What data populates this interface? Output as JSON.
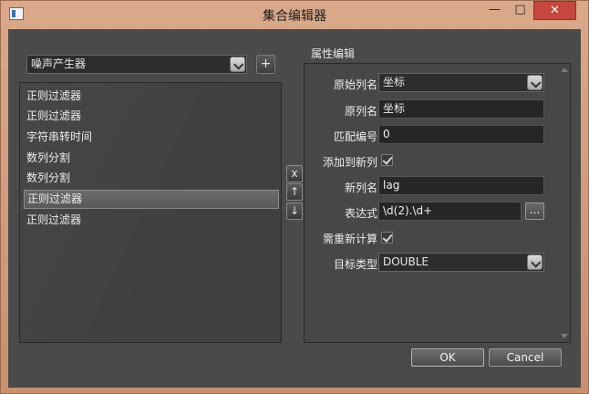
{
  "window": {
    "title": "集合编辑器",
    "min_glyph": "—",
    "max_glyph": "□",
    "close_glyph": "✕"
  },
  "left": {
    "generator_select": {
      "value": "噪声产生器"
    },
    "add_button": "+",
    "items": [
      {
        "label": "正则过滤器",
        "selected": false
      },
      {
        "label": "正则过滤器",
        "selected": false
      },
      {
        "label": "字符串转时间",
        "selected": false
      },
      {
        "label": "数列分割",
        "selected": false
      },
      {
        "label": "数列分割",
        "selected": false
      },
      {
        "label": "正则过滤器",
        "selected": true
      },
      {
        "label": "正则过滤器",
        "selected": false
      }
    ],
    "remove_button": "x",
    "up_button": "↑",
    "down_button": "↓"
  },
  "props": {
    "title": "属性编辑",
    "original_column_label": "原始列名",
    "original_column_value": "坐标",
    "source_name_label": "原列名",
    "source_name_value": "坐标",
    "match_index_label": "匹配编号",
    "match_index_value": "0",
    "add_to_new_column_label": "添加到新列",
    "add_to_new_column_checked": true,
    "new_column_label": "新列名",
    "new_column_value": "lag",
    "expression_label": "表达式",
    "expression_value": "\\d(2).\\d+",
    "expression_button": "...",
    "recalculate_label": "需重新计算",
    "recalculate_checked": true,
    "target_type_label": "目标类型",
    "target_type_value": "DOUBLE"
  },
  "buttons": {
    "ok": "OK",
    "cancel": "Cancel"
  }
}
